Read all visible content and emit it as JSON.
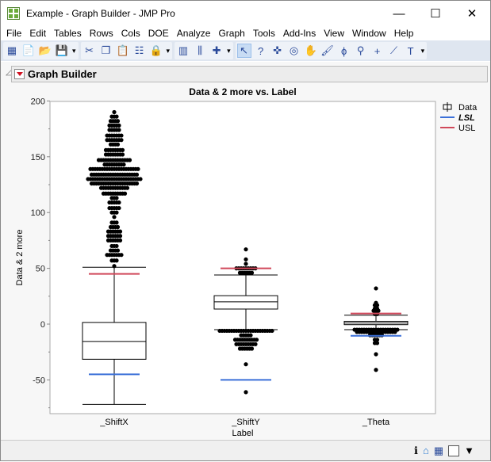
{
  "window": {
    "title": "Example - Graph Builder - JMP Pro",
    "minimize": "—",
    "maximize": "☐",
    "close": "✕"
  },
  "menu": [
    "File",
    "Edit",
    "Tables",
    "Rows",
    "Cols",
    "DOE",
    "Analyze",
    "Graph",
    "Tools",
    "Add-Ins",
    "View",
    "Window",
    "Help"
  ],
  "toolbar": [
    [
      "new-data-table-icon",
      "new-script-icon",
      "open-icon",
      "save-icon"
    ],
    [
      "cut-icon",
      "copy-icon",
      "paste-icon",
      "settings-icon",
      "lock-icon"
    ],
    [
      "data-table-icon",
      "columns-icon",
      "add-icon"
    ],
    [
      "arrow-icon",
      "help-icon",
      "crosshair-icon",
      "target-icon",
      "hand-icon",
      "brush-icon",
      "lasso-icon",
      "magnifier-icon",
      "plus-icon",
      "ruler-icon",
      "text-icon"
    ]
  ],
  "panel": {
    "title": "Graph Builder"
  },
  "chart_data": {
    "type": "box",
    "title": "Data & 2 more vs. Label",
    "xlabel": "Label",
    "ylabel": "Data & 2 more",
    "ylim": [
      -80,
      200
    ],
    "yticks": [
      200,
      150,
      100,
      50,
      0,
      -50
    ],
    "categories": [
      "_ShiftX",
      "_ShiftY",
      "_Theta"
    ],
    "legend": {
      "placement": "right",
      "items": [
        {
          "label": "Data",
          "kind": "box"
        },
        {
          "label": "LSL",
          "kind": "line",
          "color": "#3a6fd8"
        },
        {
          "label": "USL",
          "kind": "line",
          "color": "#d0485a"
        }
      ]
    },
    "boxes": [
      {
        "whisker_high": 51,
        "q3": 1.5,
        "median": -15.5,
        "q1": -31.5,
        "whisker_low": -72,
        "usl": 45,
        "lsl": -45,
        "outliers": [
          [
            190,
            1
          ],
          [
            186,
            3
          ],
          [
            182,
            4
          ],
          [
            178,
            5
          ],
          [
            174,
            5
          ],
          [
            169,
            7
          ],
          [
            165,
            7
          ],
          [
            161,
            4
          ],
          [
            156,
            8
          ],
          [
            152,
            8
          ],
          [
            147,
            14
          ],
          [
            143,
            9
          ],
          [
            139,
            21
          ],
          [
            134,
            20
          ],
          [
            130,
            23
          ],
          [
            126,
            20
          ],
          [
            122,
            12
          ],
          [
            117,
            10
          ],
          [
            113,
            3
          ],
          [
            109,
            5
          ],
          [
            104,
            5
          ],
          [
            100,
            3
          ],
          [
            96,
            1
          ],
          [
            91,
            3
          ],
          [
            87,
            4
          ],
          [
            83,
            6
          ],
          [
            79,
            6
          ],
          [
            75,
            6
          ],
          [
            70,
            3
          ],
          [
            66,
            4
          ],
          [
            62,
            7
          ],
          [
            57,
            3
          ],
          [
            52,
            1
          ]
        ]
      },
      {
        "whisker_high": 44,
        "q3": 25.5,
        "median": 20,
        "q1": 13.5,
        "whisker_low": -5,
        "usl": 50,
        "lsl": -50,
        "outliers": [
          [
            67,
            1
          ],
          [
            58,
            1
          ],
          [
            54,
            1
          ],
          [
            50,
            9
          ],
          [
            46,
            6
          ],
          [
            -6,
            23
          ],
          [
            -10,
            5
          ],
          [
            -14,
            10
          ],
          [
            -18,
            9
          ],
          [
            -22,
            6
          ],
          [
            -36,
            1
          ],
          [
            -61,
            1
          ]
        ]
      },
      {
        "whisker_high": 8,
        "q3": 2.5,
        "median": 1,
        "q1": -0.5,
        "whisker_low": -5,
        "usl": 9.5,
        "lsl": -10.5,
        "outliers": [
          [
            32,
            1
          ],
          [
            19,
            1
          ],
          [
            17,
            2
          ],
          [
            14,
            2
          ],
          [
            12,
            3
          ],
          [
            9,
            2
          ],
          [
            -5,
            19
          ],
          [
            -7,
            17
          ],
          [
            -10,
            6
          ],
          [
            -14,
            2
          ],
          [
            -17,
            2
          ],
          [
            -27,
            1
          ],
          [
            -41,
            1
          ]
        ]
      }
    ],
    "colors": {
      "lsl": "#3a6fd8",
      "usl": "#d0485a"
    }
  }
}
